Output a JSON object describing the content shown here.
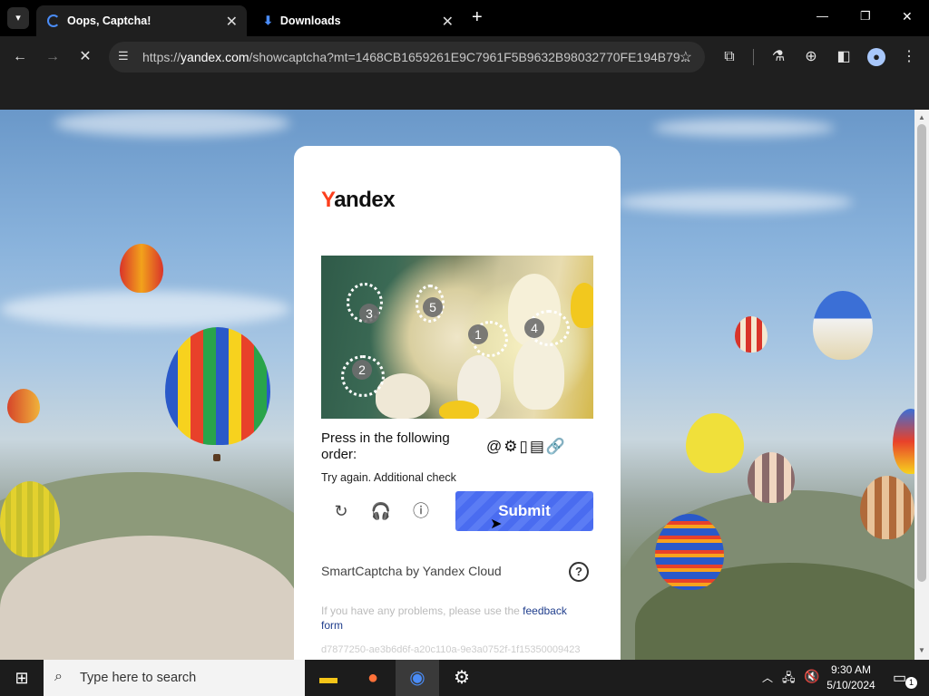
{
  "browser": {
    "tabs": [
      {
        "title": "Oops, Captcha!",
        "active": true
      },
      {
        "title": "Downloads",
        "active": false
      }
    ],
    "url_prefix": "https://",
    "url_domain": "yandex.com",
    "url_rest": "/showcaptcha?mt=1468CB1659261E9C7961F5B9632B98032770FE194B79...",
    "window_controls": {
      "minimize": "—",
      "restore": "❐",
      "close": "✕"
    }
  },
  "captcha": {
    "logo_first": "Y",
    "logo_rest": "andex",
    "markers": [
      "3",
      "5",
      "1",
      "4",
      "2"
    ],
    "instruction": "Press in the following order:",
    "order_icons": "@⚙▯▤🔗",
    "error": "Try again. Additional check",
    "submit_label": "Submit",
    "brand": "SmartCaptcha by Yandex Cloud",
    "help": "?",
    "problems_text": "If you have any problems, please use the ",
    "problems_link": "feedback form",
    "hash": "d7877250-ae3b6d6f-a20c110a-9e3a0752f-1f15350009423"
  },
  "taskbar": {
    "search_placeholder": "Type here to search",
    "time": "9:30 AM",
    "date": "5/10/2024",
    "notification_count": "1"
  }
}
